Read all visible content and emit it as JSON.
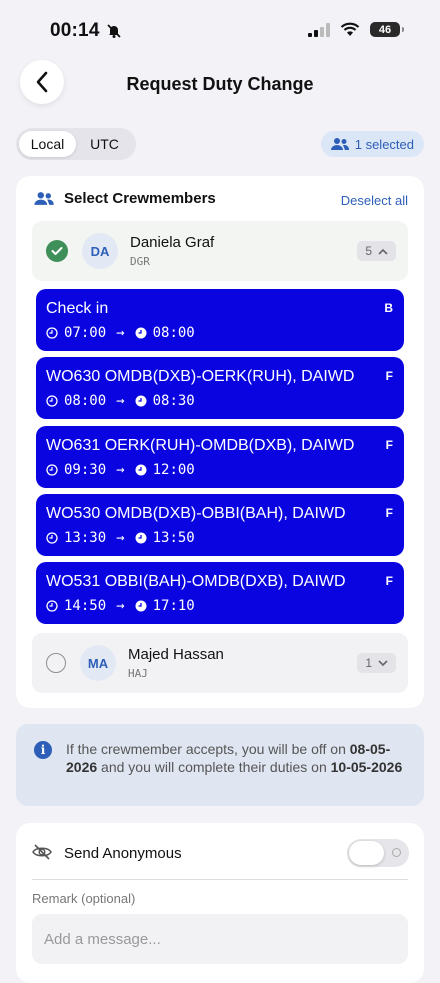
{
  "status": {
    "time": "00:14",
    "battery": "46"
  },
  "header": {
    "title": "Request Duty Change"
  },
  "timezone": {
    "options": [
      "Local",
      "UTC"
    ],
    "selected": "Local"
  },
  "selection": {
    "label": "1 selected"
  },
  "crew_section": {
    "title": "Select Crewmembers",
    "deselect_label": "Deselect all"
  },
  "crew": [
    {
      "initials": "DA",
      "name": "Daniela Graf",
      "code": "DGR",
      "count": "5",
      "selected": true,
      "duties": [
        {
          "title": "Check in",
          "tag": "B",
          "start": "07:00",
          "end": "08:00"
        },
        {
          "title": "WO630 OMDB(DXB)-OERK(RUH), DAIWD",
          "tag": "F",
          "start": "08:00",
          "end": "08:30"
        },
        {
          "title": "WO631 OERK(RUH)-OMDB(DXB), DAIWD",
          "tag": "F",
          "start": "09:30",
          "end": "12:00"
        },
        {
          "title": "WO530 OMDB(DXB)-OBBI(BAH), DAIWD",
          "tag": "F",
          "start": "13:30",
          "end": "13:50"
        },
        {
          "title": "WO531 OBBI(BAH)-OMDB(DXB), DAIWD",
          "tag": "F",
          "start": "14:50",
          "end": "17:10"
        }
      ]
    },
    {
      "initials": "MA",
      "name": "Majed Hassan",
      "code": "HAJ",
      "count": "1",
      "selected": false
    }
  ],
  "info": {
    "part1": "If the crewmember accepts, you will be off on",
    "date_off": "08-05-2026",
    "part2": "and you will complete their duties on",
    "date_complete": "10-05-2026"
  },
  "anonymous": {
    "label": "Send Anonymous",
    "enabled": false
  },
  "remark": {
    "label": "Remark (optional)",
    "placeholder": "Add a message..."
  },
  "colors": {
    "accent": "#2d5fb8",
    "duty_block": "#0a05e0",
    "selected_check": "#3f8f5a"
  }
}
